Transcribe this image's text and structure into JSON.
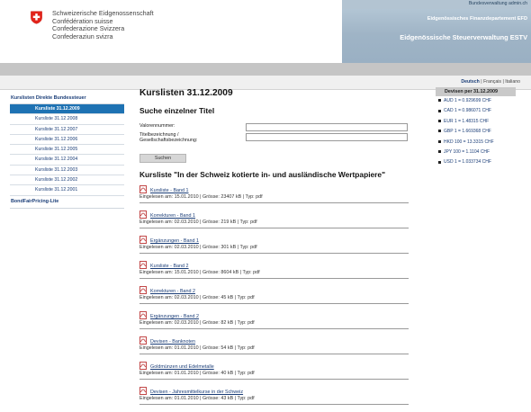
{
  "header": {
    "conf_names": [
      "Schweizerische Eidgenossenschaft",
      "Confédération suisse",
      "Confederazione Svizzera",
      "Confederaziun svizra"
    ],
    "site": "Bundesverwaltung admin.ch",
    "department": "Eidgenössisches Finanzdepartement EFD",
    "office": "Eidgenössische Steuerverwaltung ESTV"
  },
  "languages": {
    "de": "Deutsch",
    "fr": "Français",
    "it": "Italiano",
    "sep": "|"
  },
  "sidebar": {
    "heading": "Kurslisten Direkte Bundessteuer",
    "items": [
      "Kursliste 31.12.2009",
      "Kursliste 31.12.2008",
      "Kursliste 31.12.2007",
      "Kursliste 31.12.2006",
      "Kursliste 31.12.2005",
      "Kursliste 31.12.2004",
      "Kursliste 31.12.2003",
      "Kursliste 31.12.2002",
      "Kursliste 31.12.2001"
    ],
    "active_index": 0,
    "bottom": "BondFairPricing-Lite"
  },
  "main": {
    "title": "Kurslisten 31.12.2009",
    "search_title": "Suche einzelner Titel",
    "label_valor": "Valorennummer:",
    "label_title_1": "Titelbezeichnung /",
    "label_title_2": "Gesellschaftsbezeichnung:",
    "value_valor": "",
    "value_title": "",
    "submit": "Suchen",
    "list_title": "Kursliste \"In der Schweiz kotierte in- und ausländische Wertpapiere\"",
    "files": [
      {
        "name": "Kursliste - Band 1",
        "meta": "Eingelesen am: 15.01.2010 | Grösse: 23407 kB | Typ: pdf"
      },
      {
        "name": "Korrekturen - Band 1",
        "meta": "Eingelesen am: 02.03.2010 | Grösse: 219 kB | Typ: pdf"
      },
      {
        "name": "Ergänzungen - Band 1",
        "meta": "Eingelesen am: 02.03.2010 | Grösse: 301 kB | Typ: pdf"
      },
      {
        "name": "Kursliste - Band 2",
        "meta": "Eingelesen am: 15.01.2010 | Grösse: 8604 kB | Typ: pdf"
      },
      {
        "name": "Korrekturen - Band 2",
        "meta": "Eingelesen am: 02.03.2010 | Grösse: 45 kB | Typ: pdf"
      },
      {
        "name": "Ergänzungen - Band 2",
        "meta": "Eingelesen am: 02.03.2010 | Grösse: 82 kB | Typ: pdf"
      },
      {
        "name": "Devisen - Banknoten",
        "meta": "Eingelesen am: 01.01.2010 | Grösse: 54 kB | Typ: pdf"
      },
      {
        "name": "Goldmünzen und Edelmetalle",
        "meta": "Eingelesen am: 01.01.2010 | Grösse: 40 kB | Typ: pdf"
      },
      {
        "name": "Devisen - Jahresmittelkurse in der Schweiz",
        "meta": "Eingelesen am: 01.01.2010 | Grösse: 43 kB | Typ: pdf"
      }
    ]
  },
  "rates": {
    "heading": "Devisen per 31.12.2009",
    "items": [
      "AUD 1 = 0.929699 CHF",
      "CAD 1 = 0.986071 CHF",
      "EUR 1 = 1.48315 CHF",
      "GBP 1 = 1.669368 CHF",
      "HKD 100 = 13.3315 CHF",
      "JPY 100 = 1.1104 CHF",
      "USD 1 = 1.033734 CHF"
    ]
  },
  "colors": {
    "brand_blue": "#1b3e78",
    "active_blue": "#1e72b3",
    "swiss_red": "#e2231a"
  }
}
